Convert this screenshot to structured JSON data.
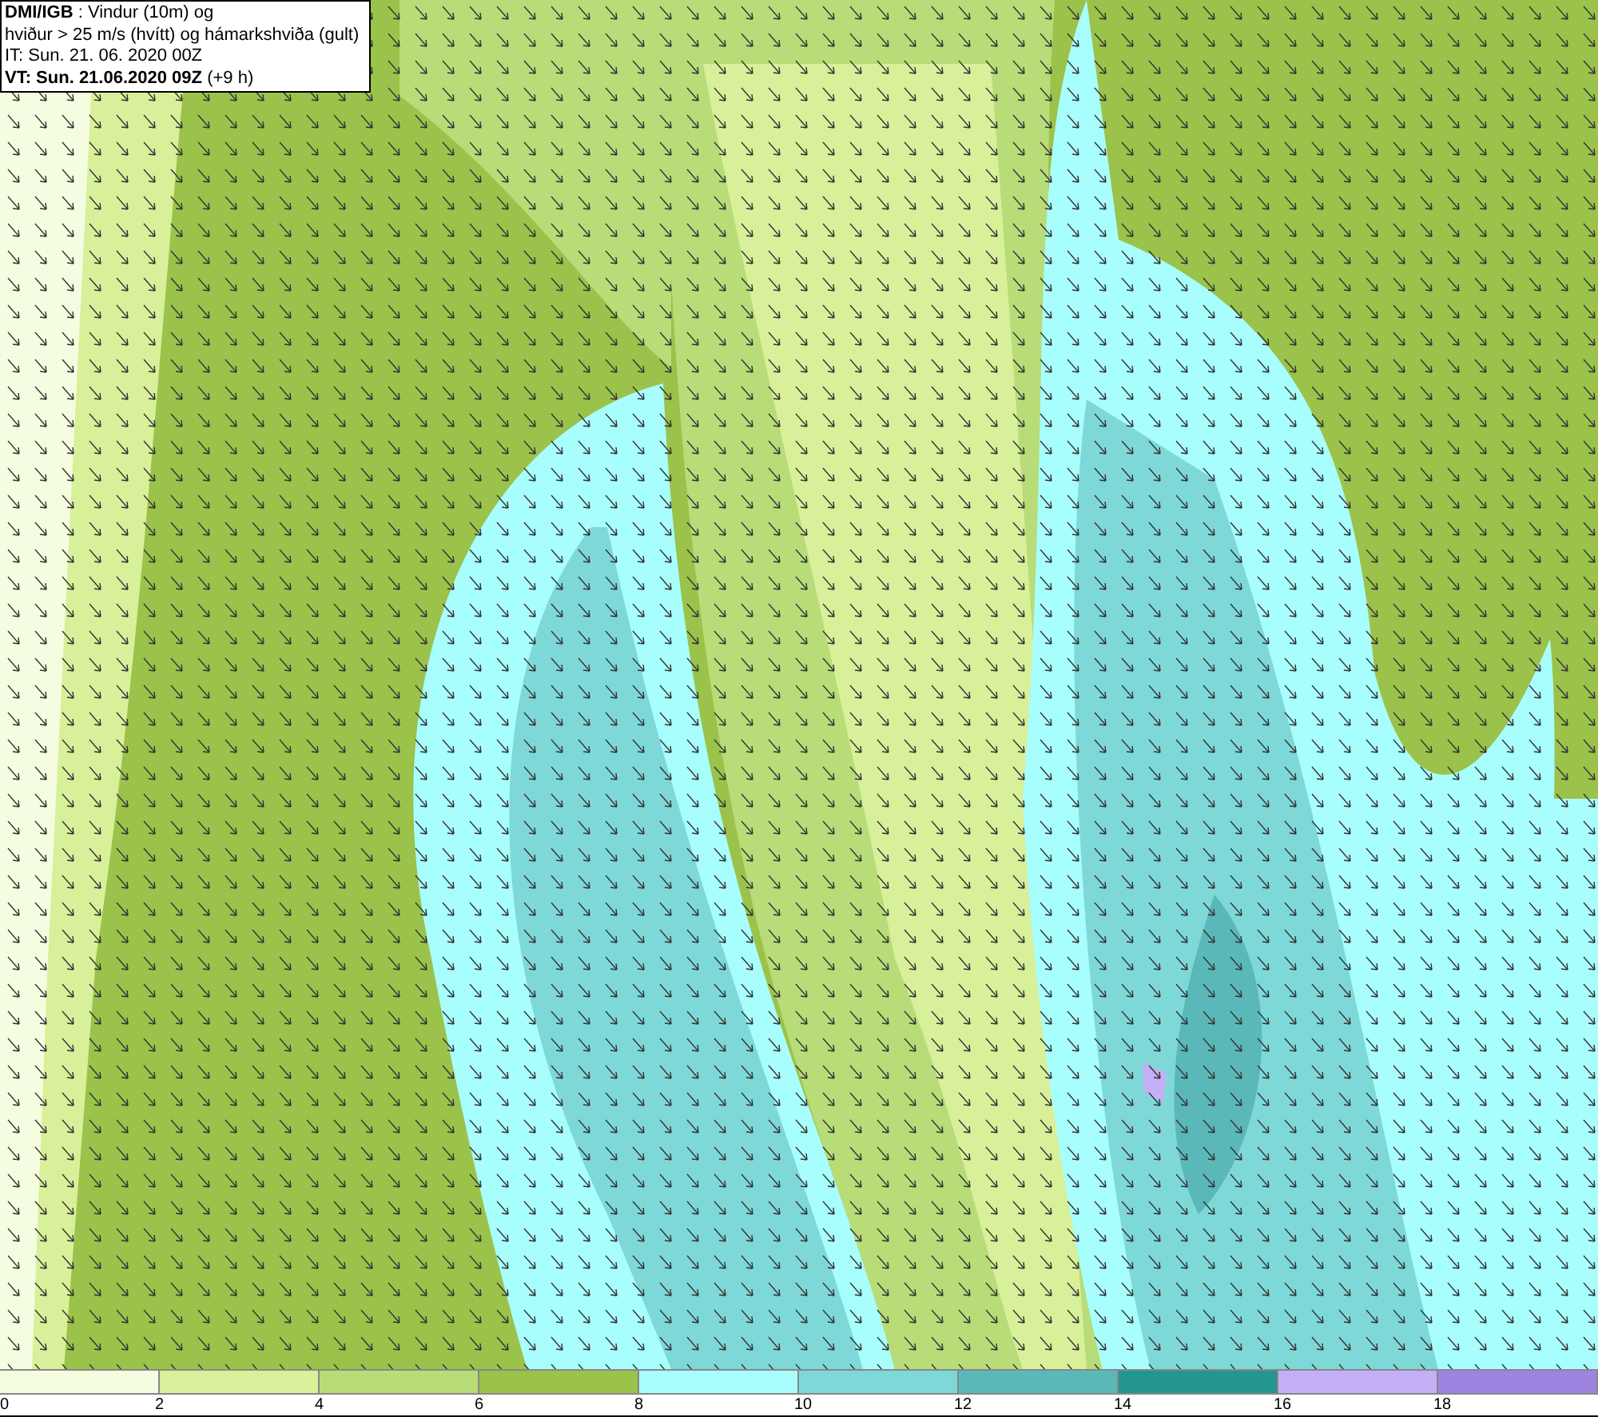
{
  "header": {
    "lines": [
      "**DMI/IGB** : Vindur (10m) og",
      "hviður > 25 m/s (hvítt) og hámarkshviða (gult)",
      "IT: Sun. 21. 06. 2020 00Z",
      "**VT: Sun. 21.06.2020 09Z** (+9 h)"
    ]
  },
  "legend": {
    "segments": [
      {
        "color": "#f5fde0"
      },
      {
        "color": "#d8f09a"
      },
      {
        "color": "#b8dc78"
      },
      {
        "color": "#9bc24a"
      },
      {
        "color": "#a8fefc"
      },
      {
        "color": "#7fd8d8"
      },
      {
        "color": "#5bb8b8"
      },
      {
        "color": "#249690"
      },
      {
        "color": "#c4aef6"
      },
      {
        "color": "#9c84e0"
      }
    ],
    "ticks": [
      "0",
      "2",
      "4",
      "6",
      "8",
      "10",
      "12",
      "14",
      "16",
      "18"
    ]
  }
}
